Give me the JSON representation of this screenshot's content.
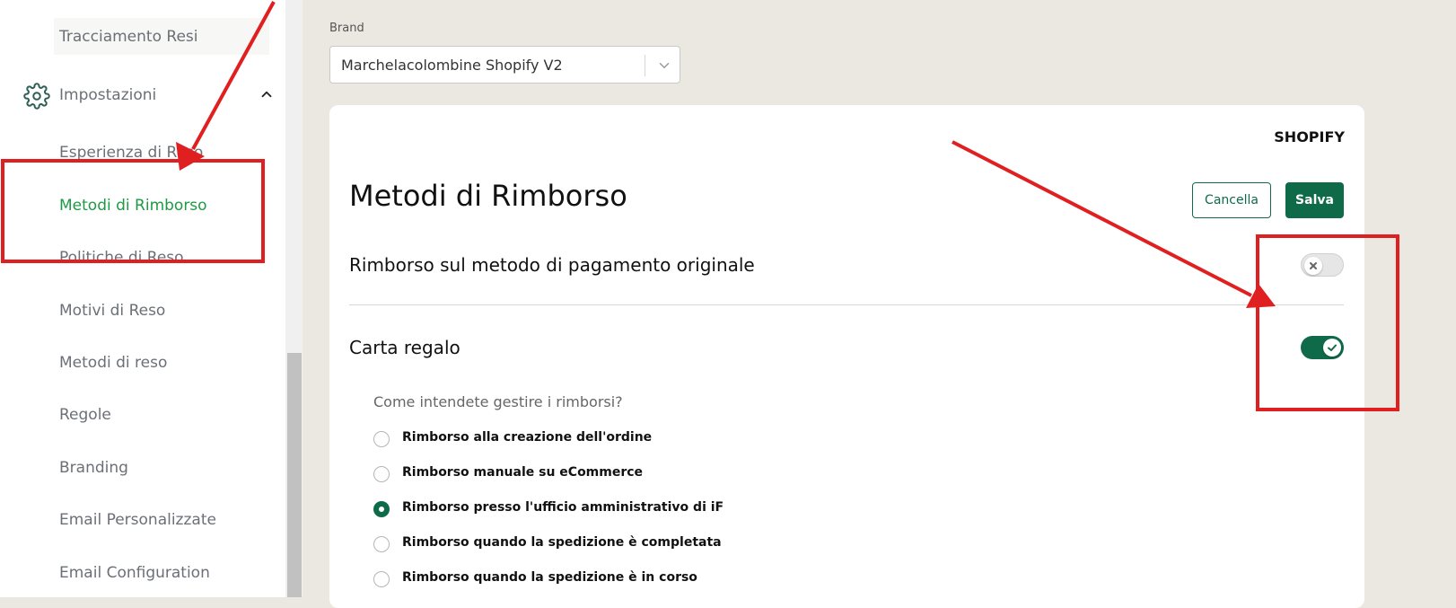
{
  "sidebar": {
    "tracking_label": "Tracciamento Resi",
    "settings_group": {
      "label": "Impostazioni",
      "icon": "gear-icon",
      "expand_icon": "chevron-up-icon"
    },
    "items": [
      {
        "label": "Esperienza di Reso",
        "active": false
      },
      {
        "label": "Metodi di Rimborso",
        "active": true
      },
      {
        "label": "Politiche di Reso",
        "active": false
      },
      {
        "label": "Motivi di Reso",
        "active": false
      },
      {
        "label": "Metodi di reso",
        "active": false
      },
      {
        "label": "Regole",
        "active": false
      },
      {
        "label": "Branding",
        "active": false
      },
      {
        "label": "Email Personalizzate",
        "active": false
      },
      {
        "label": "Email Configuration",
        "active": false
      }
    ]
  },
  "brand": {
    "label": "Brand",
    "selected": "Marchelacolombine Shopify V2"
  },
  "card": {
    "platform": "SHOPIFY",
    "title": "Metodi di Rimborso",
    "cancel_label": "Cancella",
    "save_label": "Salva",
    "original_payment": {
      "label": "Rimborso sul metodo di pagamento originale",
      "enabled": false
    },
    "gift_card": {
      "label": "Carta regalo",
      "enabled": true
    },
    "question": "Come intendete gestire i rimborsi?",
    "options": [
      {
        "label": "Rimborso alla creazione dell'ordine",
        "checked": false
      },
      {
        "label": "Rimborso manuale su eCommerce",
        "checked": false
      },
      {
        "label": "Rimborso presso l'ufficio amministrativo di iF",
        "checked": true
      },
      {
        "label": "Rimborso quando la spedizione è completata",
        "checked": false
      },
      {
        "label": "Rimborso quando la spedizione è in corso",
        "checked": false
      }
    ]
  },
  "colors": {
    "accent": "#0f6a4a",
    "active_nav": "#1e9a45",
    "annotation": "#e02020",
    "background": "#ebe7e1"
  }
}
